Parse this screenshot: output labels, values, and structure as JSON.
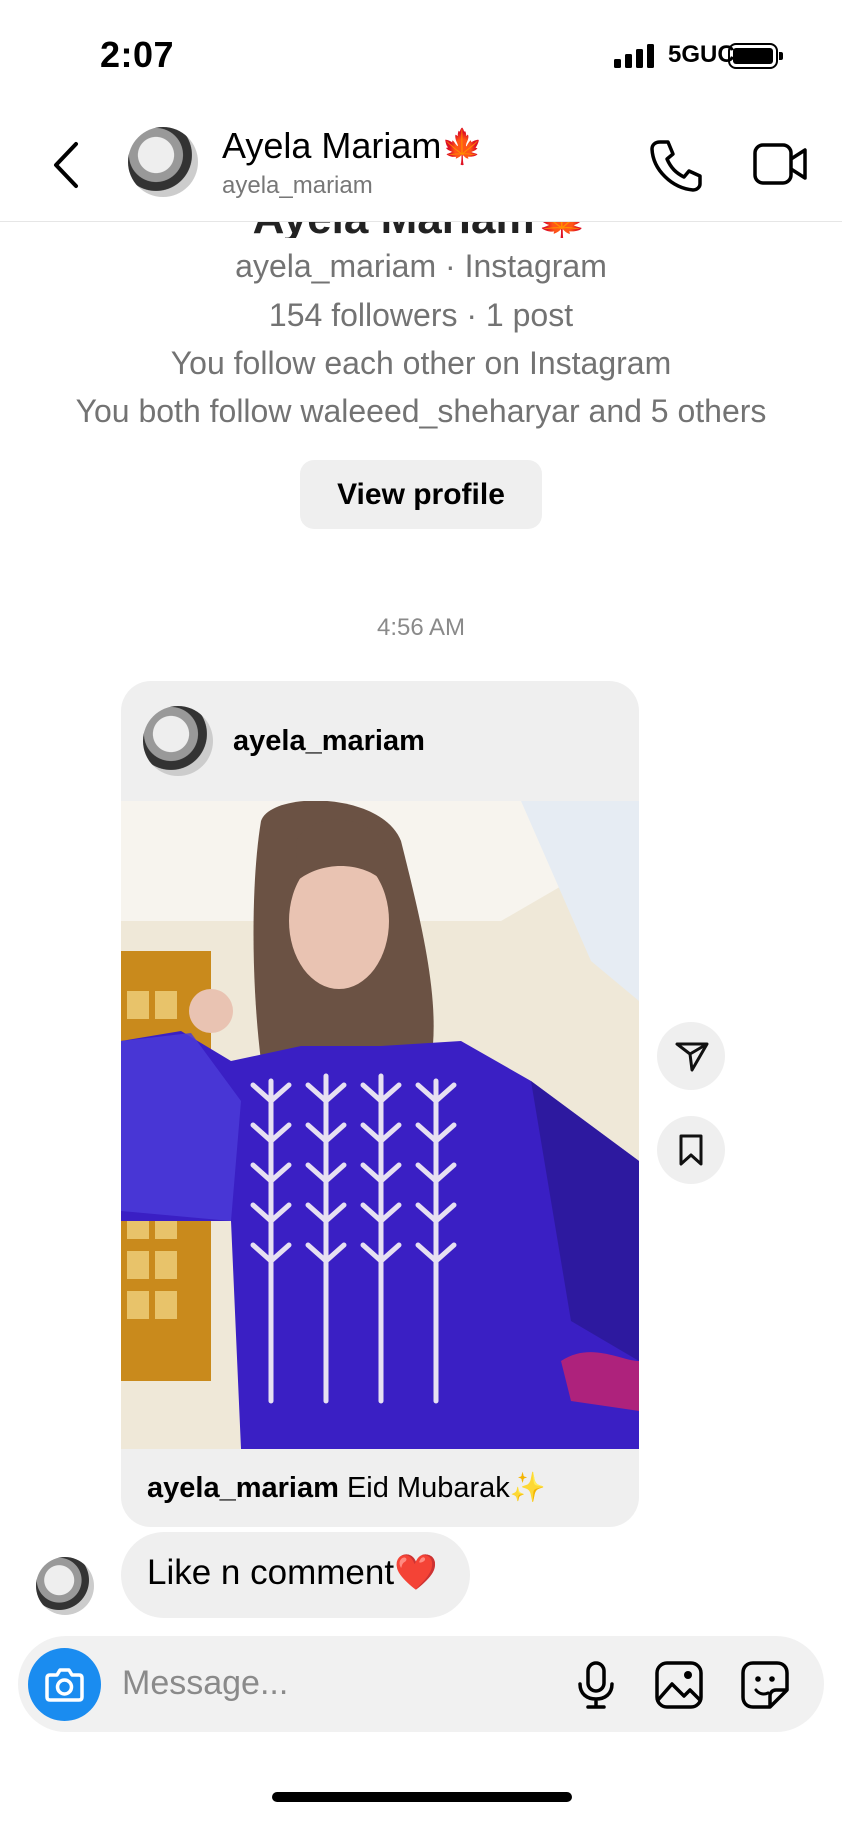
{
  "status_bar": {
    "time": "2:07",
    "network": "5GUC"
  },
  "header": {
    "name": "Ayela Mariam",
    "name_emoji": "🍁",
    "username": "ayela_mariam"
  },
  "profile": {
    "line1": "ayela_mariam · Instagram",
    "line2": "154 followers · 1 post",
    "line3": "You follow each other on Instagram",
    "line4": "You both follow waleeed_sheharyar and 5 others",
    "view_profile_label": "View profile"
  },
  "chat": {
    "timestamp": "4:56 AM",
    "shared_post": {
      "username": "ayela_mariam",
      "caption_user": "ayela_mariam",
      "caption_text": "Eid Mubarak",
      "caption_emoji": "✨"
    },
    "message": {
      "text": "Like n comment",
      "emoji": "❤️"
    }
  },
  "composer": {
    "placeholder": "Message..."
  },
  "icons": [
    "back-chevron-icon",
    "phone-icon",
    "video-camera-icon",
    "send-icon",
    "bookmark-icon",
    "camera-icon",
    "microphone-icon",
    "gallery-icon",
    "sticker-icon"
  ],
  "colors": {
    "accent": "#1a8cf0",
    "dress": "#3a1fc4"
  }
}
